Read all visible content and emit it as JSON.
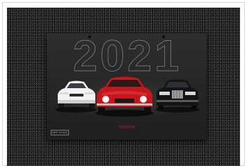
{
  "calendar": {
    "year": "2021",
    "brand": "TOYOTA",
    "code": "DEF 10-001"
  },
  "colors": {
    "background_asphalt": "#1c1c1c",
    "calendar_body": "#2a2a2a",
    "year_outline": "#8c8c8c",
    "brand_red": "#b81f24",
    "left_car": "#f2f2f2",
    "center_car": "#c4161c",
    "right_car": "#111111"
  },
  "objects": [
    "white-sports-car",
    "red-classic-sports-car",
    "black-luxury-sedan"
  ]
}
